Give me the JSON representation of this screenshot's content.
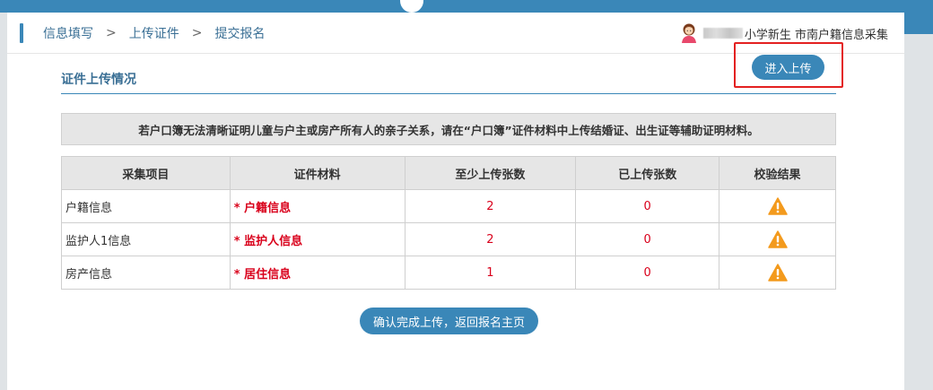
{
  "breadcrumb": {
    "step1": "信息填写",
    "step2": "上传证件",
    "step3": "提交报名",
    "separator": ">"
  },
  "user": {
    "suffix": "小学新生 市南户籍信息采集",
    "avatar_icon": "female-user-avatar-icon"
  },
  "section": {
    "title": "证件上传情况",
    "upload_button": "进入上传"
  },
  "notice": "若户口簿无法清晰证明儿童与户主或房产所有人的亲子关系，请在“户口簿”证件材料中上传结婚证、出生证等辅助证明材料。",
  "table": {
    "headers": [
      "采集项目",
      "证件材料",
      "至少上传张数",
      "已上传张数",
      "校验结果"
    ],
    "rows": [
      {
        "item": "户籍信息",
        "material": "* 户籍信息",
        "min": "2",
        "uploaded": "0",
        "result_icon": "warning-icon"
      },
      {
        "item": "监护人1信息",
        "material": "* 监护人信息",
        "min": "2",
        "uploaded": "0",
        "result_icon": "warning-icon"
      },
      {
        "item": "房产信息",
        "material": "* 居住信息",
        "min": "1",
        "uploaded": "0",
        "result_icon": "warning-icon"
      }
    ]
  },
  "confirm_button": "确认完成上传，返回报名主页",
  "colors": {
    "primary": "#3a87b8",
    "required_red": "#d9001b",
    "warning_orange": "#f39a1d",
    "highlight_frame": "#e32020"
  }
}
